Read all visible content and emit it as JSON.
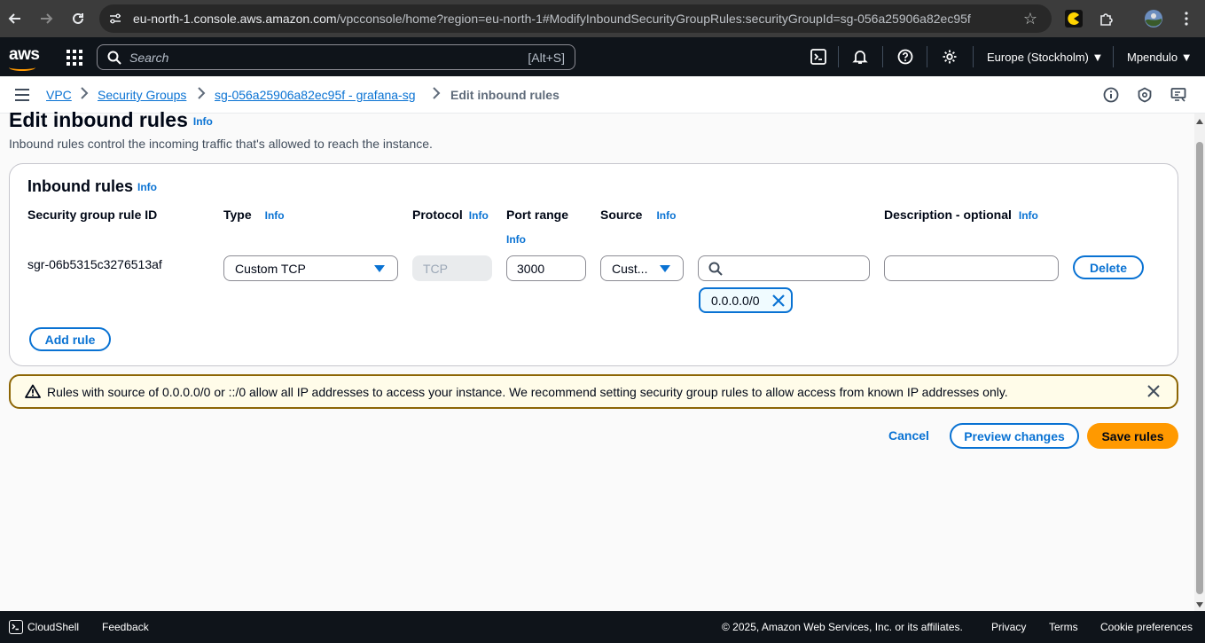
{
  "browser": {
    "url_host": "eu-north-1.console.aws.amazon.com",
    "url_path": "/vpcconsole/home?region=eu-north-1#ModifyInboundSecurityGroupRules:securityGroupId=sg-056a25906a82ec95f"
  },
  "topnav": {
    "logo": "aws",
    "search_placeholder": "Search",
    "search_shortcut": "[Alt+S]",
    "region": "Europe (Stockholm) ▼",
    "user": "Mpendulo ▼"
  },
  "breadcrumbs": {
    "vpc": "VPC",
    "security_groups": "Security Groups",
    "sg": "sg-056a25906a82ec95f - grafana-sg",
    "current": "Edit inbound rules"
  },
  "page": {
    "title": "Edit inbound rules",
    "info": "Info",
    "description": "Inbound rules control the incoming traffic that's allowed to reach the instance."
  },
  "panel": {
    "title": "Inbound rules",
    "info": "Info",
    "columns": {
      "rule_id": "Security group rule ID",
      "type": "Type",
      "protocol": "Protocol",
      "port_range": "Port range",
      "source": "Source",
      "description": "Description - optional"
    },
    "rule": {
      "id": "sgr-06b5315c3276513af",
      "type": "Custom TCP",
      "protocol": "TCP",
      "port": "3000",
      "source_type": "Cust...",
      "source_token": "0.0.0.0/0",
      "description": ""
    },
    "delete_label": "Delete",
    "add_rule_label": "Add rule"
  },
  "alert": {
    "text": "Rules with source of 0.0.0.0/0 or ::/0 allow all IP addresses to access your instance. We recommend setting security group rules to allow access from known IP addresses only."
  },
  "actions": {
    "cancel": "Cancel",
    "preview": "Preview changes",
    "save": "Save rules"
  },
  "footer": {
    "cloudshell": "CloudShell",
    "feedback": "Feedback",
    "copyright": "© 2025, Amazon Web Services, Inc. or its affiliates.",
    "privacy": "Privacy",
    "terms": "Terms",
    "cookies": "Cookie preferences"
  },
  "colors": {
    "link": "#0972d3",
    "primary": "#ff9900",
    "nav_bg": "#0f141a",
    "alert_bg": "#fffce9",
    "alert_border": "#8d6605"
  }
}
